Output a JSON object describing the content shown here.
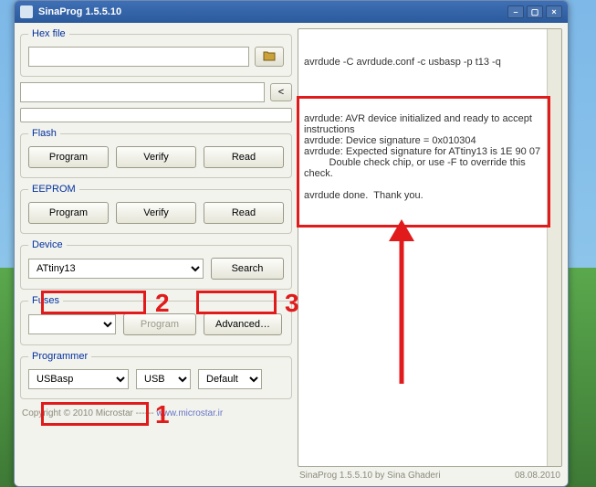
{
  "window": {
    "title": "SinaProg 1.5.5.10"
  },
  "hexfile": {
    "legend": "Hex file",
    "value": ""
  },
  "log_input": {
    "value": ""
  },
  "expand_btn": "<",
  "flash": {
    "legend": "Flash",
    "program": "Program",
    "verify": "Verify",
    "read": "Read"
  },
  "eeprom": {
    "legend": "EEPROM",
    "program": "Program",
    "verify": "Verify",
    "read": "Read"
  },
  "device": {
    "legend": "Device",
    "selected": "ATtiny13",
    "search": "Search"
  },
  "fuses": {
    "legend": "Fuses",
    "preset": "",
    "program": "Program",
    "advanced": "Advanced…"
  },
  "programmer": {
    "legend": "Programmer",
    "prog": "USBasp",
    "port": "USB",
    "speed": "Default"
  },
  "console": {
    "cmd": "avrdude -C avrdude.conf -c usbasp -p t13 -q",
    "body": "avrdude: AVR device initialized and ready to accept instructions\navrdude: Device signature = 0x010304\navrdude: Expected signature for ATtiny13 is 1E 90 07\n         Double check chip, or use -F to override this check.\n\navrdude done.  Thank you."
  },
  "footer": {
    "left_copy": "Copyright © 2010 Microstar",
    "left_link": "www.microstar.ir",
    "right_app": "SinaProg 1.5.5.10  by  Sina Ghaderi",
    "right_date": "08.08.2010"
  },
  "annotations": {
    "n1": "1",
    "n2": "2",
    "n3": "3"
  }
}
